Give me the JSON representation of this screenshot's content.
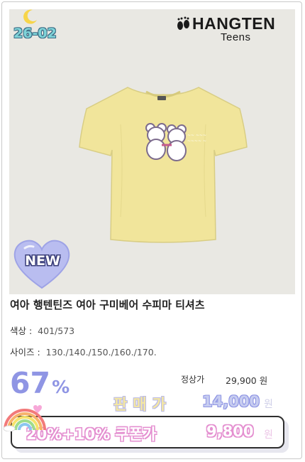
{
  "badge_code": "26-02",
  "brand": {
    "name": "HANGTEN",
    "sub": "Teens"
  },
  "badge_new": "NEW",
  "product": {
    "title": "여아 행텐틴즈 여아 구미베어 수피마 티셔츠",
    "color_label": "색상 :",
    "color_value": "401/573",
    "size_label": "사이즈 :",
    "size_value": "130./140./150./160./170."
  },
  "pricing": {
    "discount_value": "67",
    "discount_unit": "%",
    "regular_label": "정상가",
    "regular_price": "29,900 원",
    "sale_label": "판매가",
    "sale_price": "14,000",
    "sale_unit": "원",
    "coupon_label": "20%+10% 쿠폰가",
    "coupon_price": "9,800",
    "coupon_unit": "원"
  },
  "colors": {
    "shirt": "#f1e59b",
    "discount_text": "#8f95e4",
    "coupon_outline": "#e48fd0",
    "badge_heart": "#b9bdf0"
  },
  "icons": [
    "moon-icon",
    "footprint-logo-icon",
    "heart-badge-icon",
    "rainbow-icon"
  ]
}
